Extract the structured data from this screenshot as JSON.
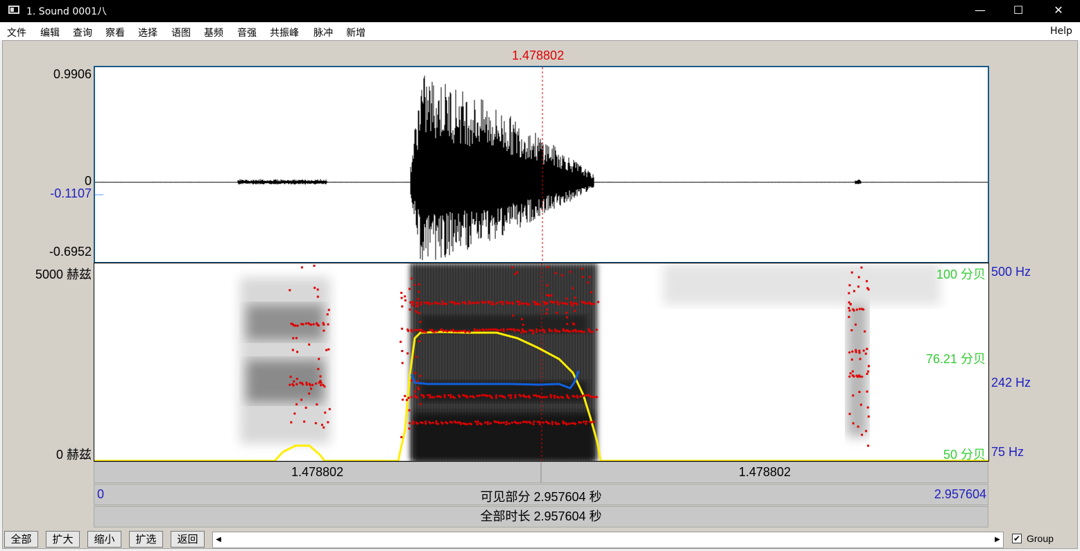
{
  "window": {
    "title": "1. Sound 0001八",
    "minimize": "—",
    "maximize": "☐",
    "close": "✕"
  },
  "menu": [
    "文件",
    "编辑",
    "查询",
    "察看",
    "选择",
    "语图",
    "基频",
    "音强",
    "共振峰",
    "脉冲",
    "新增"
  ],
  "help": "Help",
  "cursor": {
    "time_label": "1.478802"
  },
  "waveform": {
    "max_label": "0.9906",
    "zero_label": "0",
    "cursor_value": "-0.1107",
    "min_label": "-0.6952"
  },
  "spectrogram": {
    "freq_max": "5000 赫兹",
    "freq_min": "0 赫兹",
    "intensity_max": "100 分贝",
    "intensity_cursor": "76.21 分贝",
    "intensity_min": "50 分贝",
    "pitch_max": "500 Hz",
    "pitch_cursor": "242 Hz",
    "pitch_min": "75 Hz"
  },
  "time_bar": {
    "left_segment": "1.478802",
    "right_segment": "1.478802"
  },
  "visible_bar": {
    "start": "0",
    "text": "可见部分 2.957604 秒",
    "end": "2.957604"
  },
  "total_bar": {
    "text": "全部时长 2.957604 秒"
  },
  "buttons": {
    "all": "全部",
    "zoom_in": "扩大",
    "zoom_out": "缩小",
    "sel": "扩选",
    "back": "返回"
  },
  "scroll": {
    "left": "◀",
    "right": "▶"
  },
  "group": {
    "label": "Group",
    "checked": true
  },
  "colors": {
    "cursor": "#e00000",
    "formant": "#e00000",
    "intensity": "#ffee00",
    "pitch": "#1060e0",
    "axis_blue": "#2020c0",
    "axis_green": "#33cc33"
  }
}
